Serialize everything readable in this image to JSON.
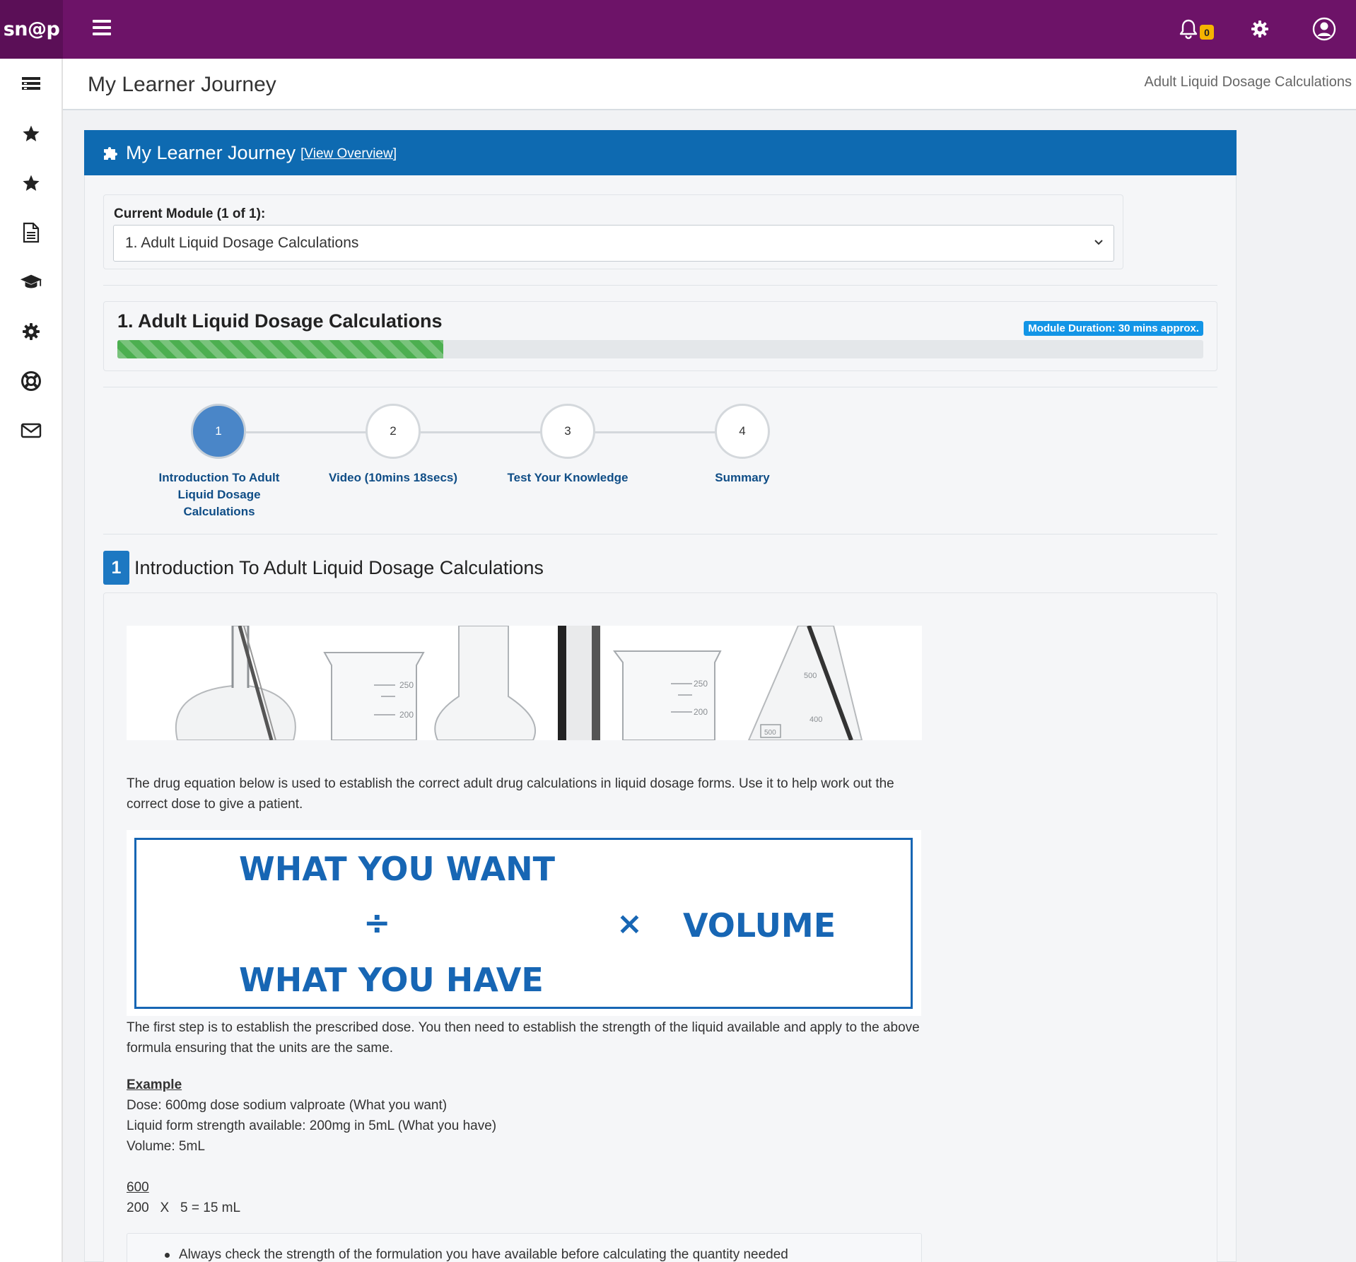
{
  "app": {
    "logo_text": "sn@p",
    "notification_count": "0",
    "brand_color": "#6d1368"
  },
  "sidebar": {
    "items": [
      {
        "icon": "list-icon"
      },
      {
        "icon": "star-icon"
      },
      {
        "icon": "star-icon"
      },
      {
        "icon": "document-icon"
      },
      {
        "icon": "graduation-cap-icon"
      },
      {
        "icon": "gear-icon"
      },
      {
        "icon": "life-ring-icon"
      },
      {
        "icon": "envelope-icon"
      }
    ]
  },
  "header": {
    "title": "My Learner Journey",
    "breadcrumb": "Adult Liquid Dosage Calculations"
  },
  "panel": {
    "title": "My Learner Journey",
    "link": "[View Overview]",
    "header_color": "#0e6ab1"
  },
  "module": {
    "label": "Current Module (1 of 1):",
    "selected": "1. Adult Liquid Dosage Calculations"
  },
  "progress": {
    "title": "1. Adult Liquid Dosage Calculations",
    "duration": "Module Duration: 30 mins approx.",
    "percent": 30
  },
  "steps": [
    {
      "number": "1",
      "label": "Introduction To Adult Liquid Dosage Calculations",
      "active": true
    },
    {
      "number": "2",
      "label": "Video (10mins 18secs)",
      "active": false
    },
    {
      "number": "3",
      "label": "Test Your Knowledge",
      "active": false
    },
    {
      "number": "4",
      "label": "Summary",
      "active": false
    }
  ],
  "section": {
    "number": "1",
    "title": "Introduction To Adult Liquid Dosage Calculations",
    "intro": "The drug equation below is used to establish the correct adult drug calculations in liquid dosage forms. Use it to help work out the correct dose to give a patient.",
    "formula": {
      "want": "WHAT YOU WANT",
      "divide": "÷",
      "have": "WHAT YOU HAVE",
      "times": "×",
      "volume": "VOLUME"
    },
    "first_step": "The first step is to establish the prescribed dose. You then need to establish the strength of the liquid available and apply to the above formula ensuring that the units are the same.",
    "example_heading": "Example",
    "example_lines": [
      "Dose: 600mg dose sodium valproate (What you want)",
      "Liquid form strength available: 200mg in 5mL (What you have)",
      "Volume: 5mL"
    ],
    "calc_numerator": "600",
    "calc_line": "200   X   5 = 15 mL",
    "notes": [
      "Always check the strength of the formulation you have available before calculating the quantity needed"
    ],
    "banner_labels": [
      "250",
      "200",
      "250",
      "200",
      "500",
      "400",
      "500"
    ]
  }
}
